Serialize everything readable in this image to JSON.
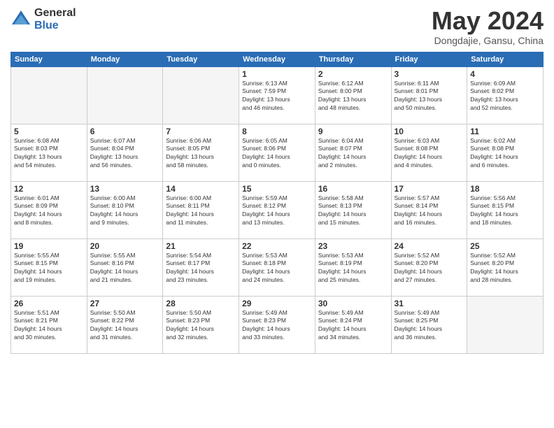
{
  "header": {
    "logo": {
      "general": "General",
      "blue": "Blue"
    },
    "title": "May 2024",
    "location": "Dongdajie, Gansu, China"
  },
  "weekdays": [
    "Sunday",
    "Monday",
    "Tuesday",
    "Wednesday",
    "Thursday",
    "Friday",
    "Saturday"
  ],
  "weeks": [
    [
      {
        "day": "",
        "info": ""
      },
      {
        "day": "",
        "info": ""
      },
      {
        "day": "",
        "info": ""
      },
      {
        "day": "1",
        "info": "Sunrise: 6:13 AM\nSunset: 7:59 PM\nDaylight: 13 hours\nand 46 minutes."
      },
      {
        "day": "2",
        "info": "Sunrise: 6:12 AM\nSunset: 8:00 PM\nDaylight: 13 hours\nand 48 minutes."
      },
      {
        "day": "3",
        "info": "Sunrise: 6:11 AM\nSunset: 8:01 PM\nDaylight: 13 hours\nand 50 minutes."
      },
      {
        "day": "4",
        "info": "Sunrise: 6:09 AM\nSunset: 8:02 PM\nDaylight: 13 hours\nand 52 minutes."
      }
    ],
    [
      {
        "day": "5",
        "info": "Sunrise: 6:08 AM\nSunset: 8:03 PM\nDaylight: 13 hours\nand 54 minutes."
      },
      {
        "day": "6",
        "info": "Sunrise: 6:07 AM\nSunset: 8:04 PM\nDaylight: 13 hours\nand 56 minutes."
      },
      {
        "day": "7",
        "info": "Sunrise: 6:06 AM\nSunset: 8:05 PM\nDaylight: 13 hours\nand 58 minutes."
      },
      {
        "day": "8",
        "info": "Sunrise: 6:05 AM\nSunset: 8:06 PM\nDaylight: 14 hours\nand 0 minutes."
      },
      {
        "day": "9",
        "info": "Sunrise: 6:04 AM\nSunset: 8:07 PM\nDaylight: 14 hours\nand 2 minutes."
      },
      {
        "day": "10",
        "info": "Sunrise: 6:03 AM\nSunset: 8:08 PM\nDaylight: 14 hours\nand 4 minutes."
      },
      {
        "day": "11",
        "info": "Sunrise: 6:02 AM\nSunset: 8:08 PM\nDaylight: 14 hours\nand 6 minutes."
      }
    ],
    [
      {
        "day": "12",
        "info": "Sunrise: 6:01 AM\nSunset: 8:09 PM\nDaylight: 14 hours\nand 8 minutes."
      },
      {
        "day": "13",
        "info": "Sunrise: 6:00 AM\nSunset: 8:10 PM\nDaylight: 14 hours\nand 9 minutes."
      },
      {
        "day": "14",
        "info": "Sunrise: 6:00 AM\nSunset: 8:11 PM\nDaylight: 14 hours\nand 11 minutes."
      },
      {
        "day": "15",
        "info": "Sunrise: 5:59 AM\nSunset: 8:12 PM\nDaylight: 14 hours\nand 13 minutes."
      },
      {
        "day": "16",
        "info": "Sunrise: 5:58 AM\nSunset: 8:13 PM\nDaylight: 14 hours\nand 15 minutes."
      },
      {
        "day": "17",
        "info": "Sunrise: 5:57 AM\nSunset: 8:14 PM\nDaylight: 14 hours\nand 16 minutes."
      },
      {
        "day": "18",
        "info": "Sunrise: 5:56 AM\nSunset: 8:15 PM\nDaylight: 14 hours\nand 18 minutes."
      }
    ],
    [
      {
        "day": "19",
        "info": "Sunrise: 5:55 AM\nSunset: 8:15 PM\nDaylight: 14 hours\nand 19 minutes."
      },
      {
        "day": "20",
        "info": "Sunrise: 5:55 AM\nSunset: 8:16 PM\nDaylight: 14 hours\nand 21 minutes."
      },
      {
        "day": "21",
        "info": "Sunrise: 5:54 AM\nSunset: 8:17 PM\nDaylight: 14 hours\nand 23 minutes."
      },
      {
        "day": "22",
        "info": "Sunrise: 5:53 AM\nSunset: 8:18 PM\nDaylight: 14 hours\nand 24 minutes."
      },
      {
        "day": "23",
        "info": "Sunrise: 5:53 AM\nSunset: 8:19 PM\nDaylight: 14 hours\nand 25 minutes."
      },
      {
        "day": "24",
        "info": "Sunrise: 5:52 AM\nSunset: 8:20 PM\nDaylight: 14 hours\nand 27 minutes."
      },
      {
        "day": "25",
        "info": "Sunrise: 5:52 AM\nSunset: 8:20 PM\nDaylight: 14 hours\nand 28 minutes."
      }
    ],
    [
      {
        "day": "26",
        "info": "Sunrise: 5:51 AM\nSunset: 8:21 PM\nDaylight: 14 hours\nand 30 minutes."
      },
      {
        "day": "27",
        "info": "Sunrise: 5:50 AM\nSunset: 8:22 PM\nDaylight: 14 hours\nand 31 minutes."
      },
      {
        "day": "28",
        "info": "Sunrise: 5:50 AM\nSunset: 8:23 PM\nDaylight: 14 hours\nand 32 minutes."
      },
      {
        "day": "29",
        "info": "Sunrise: 5:49 AM\nSunset: 8:23 PM\nDaylight: 14 hours\nand 33 minutes."
      },
      {
        "day": "30",
        "info": "Sunrise: 5:49 AM\nSunset: 8:24 PM\nDaylight: 14 hours\nand 34 minutes."
      },
      {
        "day": "31",
        "info": "Sunrise: 5:49 AM\nSunset: 8:25 PM\nDaylight: 14 hours\nand 36 minutes."
      },
      {
        "day": "",
        "info": ""
      }
    ]
  ]
}
